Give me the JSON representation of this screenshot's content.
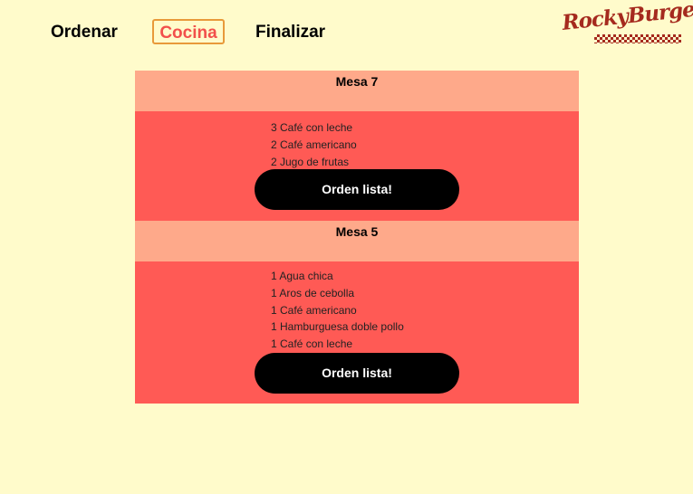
{
  "nav": {
    "ordenar": "Ordenar",
    "cocina": "Cocina",
    "finalizar": "Finalizar"
  },
  "logo": {
    "text": "RockyBurger"
  },
  "colors": {
    "background": "#FFFBCB",
    "order_header": "#FEA98A",
    "order_body": "#FF5A55",
    "active_tab_border": "#E89A3A",
    "active_tab_text": "#F2504B",
    "logo": "#A52A1E"
  },
  "orders": [
    {
      "table": "Mesa 7",
      "items": [
        "3 Café con leche",
        "2 Café americano",
        "2 Jugo de frutas"
      ],
      "button": "Orden lista!"
    },
    {
      "table": "Mesa 5",
      "items": [
        "1 Agua chica",
        "1 Aros de cebolla",
        "1 Café americano",
        "1 Hamburguesa doble pollo",
        "1 Café con leche"
      ],
      "button": "Orden lista!"
    }
  ]
}
